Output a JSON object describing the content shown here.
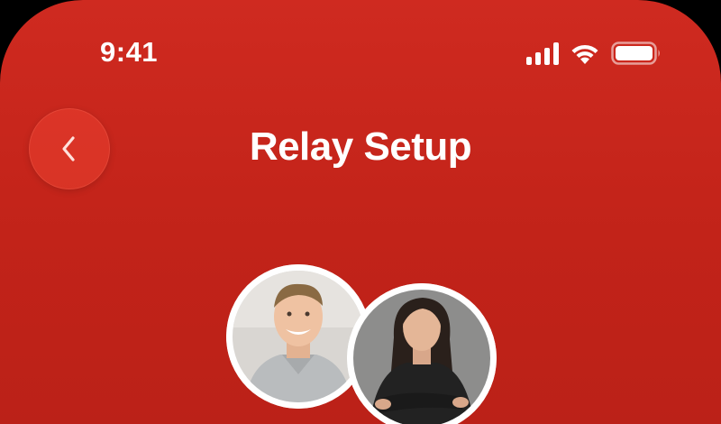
{
  "status_bar": {
    "time": "9:41",
    "icons": [
      "cellular-signal-icon",
      "wifi-icon",
      "battery-icon"
    ]
  },
  "header": {
    "title": "Relay Setup",
    "back_icon": "chevron-left-icon"
  },
  "participants": [
    {
      "avatar": "man-photo"
    },
    {
      "avatar": "woman-photo"
    }
  ],
  "colors": {
    "background": "#c8251b",
    "back_button": "#e4402f",
    "text": "#ffffff",
    "avatar_border": "#ffffff"
  }
}
